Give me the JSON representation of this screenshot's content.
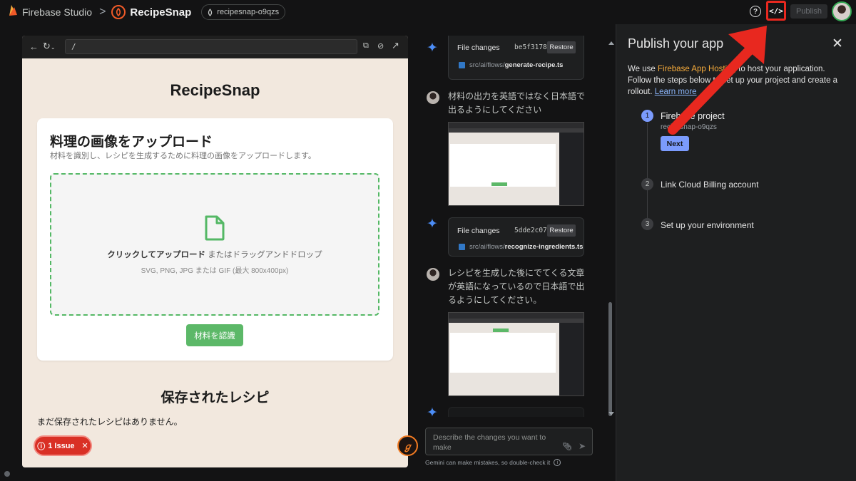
{
  "topbar": {
    "brand": "Firebase Studio",
    "separator": ">",
    "app_name": "RecipeSnap",
    "project_id": "recipesnap-o9qzs",
    "help_icon": "?",
    "code_icon": "</>",
    "publish_label": "Publish"
  },
  "preview": {
    "url": "/",
    "title": "RecipeSnap",
    "upload_title": "料理の画像をアップロード",
    "upload_desc": "材料を識別し、レシピを生成するために料理の画像をアップロードします。",
    "drop_main_bold": "クリックしてアップロード",
    "drop_main_rest": " またはドラッグアンドドロップ",
    "drop_sub": "SVG, PNG, JPG または GIF (最大 800x400px)",
    "recognize_label": "材料を認識",
    "saved_title": "保存されたレシピ",
    "saved_empty": "まだ保存されたレシピはありません。",
    "issue_label": "1 Issue",
    "issue_close": "✕"
  },
  "chat": {
    "file_change_1": {
      "label": "File changes",
      "hash": "be5f3178",
      "restore": "Restore",
      "path": "src/ai/flows/",
      "file": "generate-recipe.ts"
    },
    "user_msg_1": "材料の出力を英語ではなく日本語で出るようにしてください",
    "file_change_2": {
      "label": "File changes",
      "hash": "5dde2c07",
      "restore": "Restore",
      "path": "src/ai/flows/",
      "file": "recognize-ingredients.ts"
    },
    "user_msg_2": "レシピを生成した後にでてくる文章が英語になっているので日本語で出るようにしてください。",
    "input_placeholder": "Describe the changes you want to make",
    "disclaimer": "Gemini can make mistakes, so double-check it",
    "gemini_icon_text": "ℊ"
  },
  "publish_panel": {
    "title": "Publish your app",
    "close": "✕",
    "desc_pre": "We use ",
    "desc_product": "Firebase App Hosting",
    "desc_post": " to host your application. Follow the steps below to set up your project and create a rollout. ",
    "learn_more": "Learn more",
    "steps": [
      {
        "num": "1",
        "label": "Firebase project",
        "sub": "recipesnap-o9qzs",
        "action": "Next"
      },
      {
        "num": "2",
        "label": "Link Cloud Billing account"
      },
      {
        "num": "3",
        "label": "Set up your environment"
      }
    ]
  },
  "colors": {
    "accent_blue": "#7b9bfd",
    "annotation_red": "#e8281f",
    "upload_green": "#5cb868",
    "issue_red": "#d93025",
    "firebase_orange": "#f6ab3b"
  }
}
